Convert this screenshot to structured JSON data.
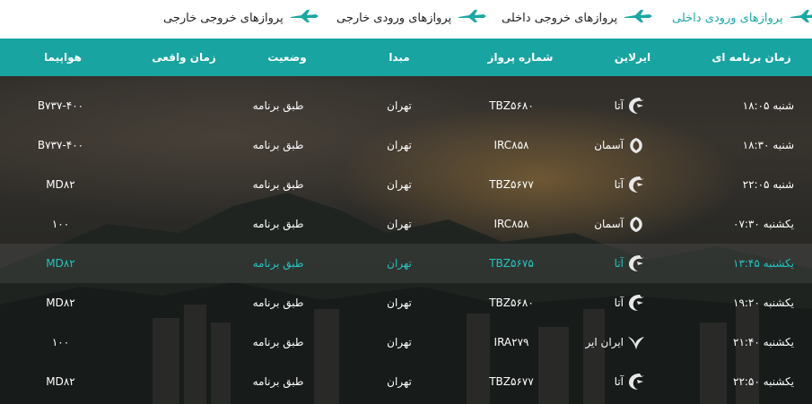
{
  "nav": {
    "tabs": [
      {
        "label": "پروازهای ورودی داخلی",
        "active": true
      },
      {
        "label": "پروازهای خروجی داخلی",
        "active": false
      },
      {
        "label": "پروازهای ورودی خارجی",
        "active": false
      },
      {
        "label": "پروازهای خروجی خارجی",
        "active": false
      }
    ]
  },
  "table": {
    "headers": {
      "time": "زمان برنامه ای",
      "airline": "ایرلاین",
      "flight": "شماره پرواز",
      "origin": "مبدا",
      "status": "وضعیت",
      "actual": "زمان واقعی",
      "aircraft": "هواپیما"
    },
    "rows": [
      {
        "time": "شنبه ۱۸:۰۵",
        "airline": "آتا",
        "logo": "ata-logo",
        "flight": "TBZ۵۶۸۰",
        "origin": "تهران",
        "status": "طبق برنامه",
        "actual": "",
        "aircraft": "B۷۳۷-۴۰۰",
        "highlight": false
      },
      {
        "time": "شنبه ۱۸:۳۰",
        "airline": "آسمان",
        "logo": "aseman-logo",
        "flight": "IRC۸۵۸",
        "origin": "تهران",
        "status": "طبق برنامه",
        "actual": "",
        "aircraft": "B۷۳۷-۴۰۰",
        "highlight": false
      },
      {
        "time": "شنبه ۲۲:۰۵",
        "airline": "آتا",
        "logo": "ata-logo",
        "flight": "TBZ۵۶۷۷",
        "origin": "تهران",
        "status": "طبق برنامه",
        "actual": "",
        "aircraft": "MD۸۲",
        "highlight": false
      },
      {
        "time": "یکشنبه ۰۷:۳۰",
        "airline": "آسمان",
        "logo": "aseman-logo",
        "flight": "IRC۸۵۸",
        "origin": "تهران",
        "status": "طبق برنامه",
        "actual": "",
        "aircraft": "۱۰۰",
        "highlight": false
      },
      {
        "time": "یکشنبه ۱۳:۴۵",
        "airline": "آتا",
        "logo": "ata-logo",
        "flight": "TBZ۵۶۷۵",
        "origin": "تهران",
        "status": "طبق برنامه",
        "actual": "",
        "aircraft": "MD۸۲",
        "highlight": true
      },
      {
        "time": "یکشنبه ۱۹:۲۰",
        "airline": "آتا",
        "logo": "ata-logo",
        "flight": "TBZ۵۶۸۰",
        "origin": "تهران",
        "status": "طبق برنامه",
        "actual": "",
        "aircraft": "MD۸۲",
        "highlight": false
      },
      {
        "time": "یکشنبه ۲۱:۴۰",
        "airline": "ایران ایر",
        "logo": "iranair-logo",
        "flight": "IRA۲۷۹",
        "origin": "تهران",
        "status": "طبق برنامه",
        "actual": "",
        "aircraft": "۱۰۰",
        "highlight": false
      },
      {
        "time": "یکشنبه ۲۲:۵۰",
        "airline": "آتا",
        "logo": "ata-logo",
        "flight": "TBZ۵۶۷۷",
        "origin": "تهران",
        "status": "طبق برنامه",
        "actual": "",
        "aircraft": "MD۸۲",
        "highlight": false
      }
    ]
  },
  "colors": {
    "accent": "#18a5a2",
    "highlight_text": "#21c6c0",
    "text": "#ffffff"
  }
}
